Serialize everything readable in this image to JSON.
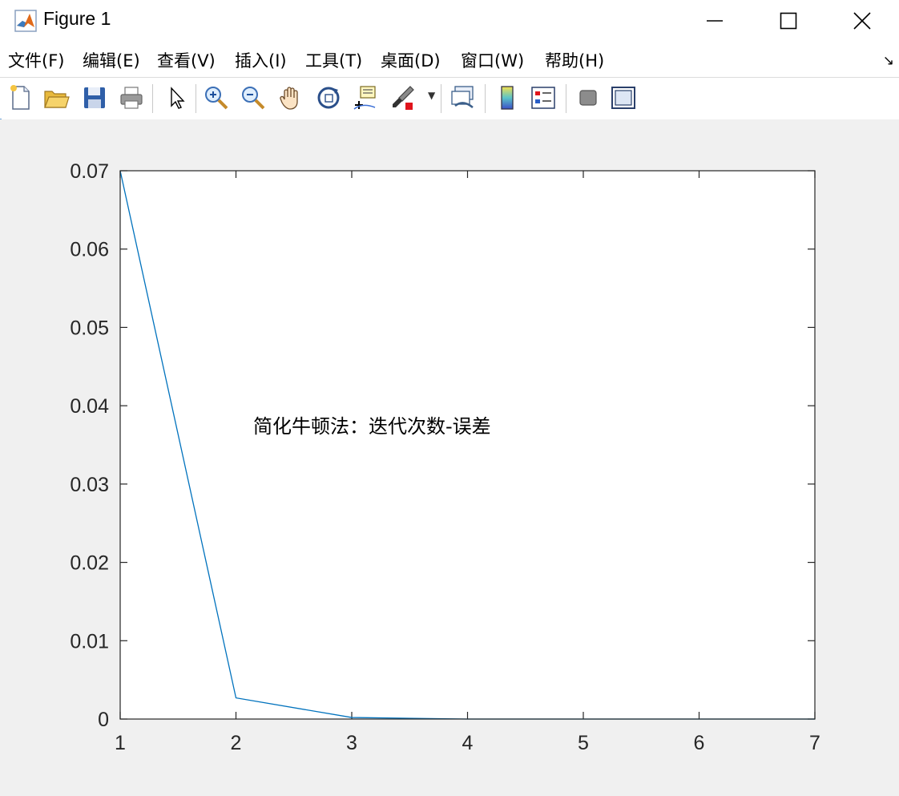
{
  "window": {
    "title": "Figure 1"
  },
  "menu": {
    "items": [
      {
        "label": "文件(F)"
      },
      {
        "label": "编辑(E)"
      },
      {
        "label": "查看(V)"
      },
      {
        "label": "插入(I)"
      },
      {
        "label": "工具(T)"
      },
      {
        "label": "桌面(D)"
      },
      {
        "label": "窗口(W)"
      },
      {
        "label": "帮助(H)"
      }
    ],
    "dock_glyph": "↘"
  },
  "toolbar": {
    "buttons": [
      {
        "icon": "new-figure-icon"
      },
      {
        "icon": "open-file-icon"
      },
      {
        "icon": "save-icon"
      },
      {
        "icon": "print-icon"
      },
      {
        "icon": "edit-plot-arrow-icon"
      },
      {
        "icon": "zoom-in-icon"
      },
      {
        "icon": "zoom-out-icon"
      },
      {
        "icon": "pan-hand-icon"
      },
      {
        "icon": "rotate-3d-icon"
      },
      {
        "icon": "data-cursor-icon"
      },
      {
        "icon": "brush-icon"
      },
      {
        "icon": "link-plot-icon"
      },
      {
        "icon": "colorbar-icon"
      },
      {
        "icon": "legend-icon"
      },
      {
        "icon": "hide-plot-tools-icon"
      },
      {
        "icon": "show-plot-tools-icon"
      }
    ]
  },
  "chart_data": {
    "type": "line",
    "title": "",
    "xlabel": "",
    "ylabel": "",
    "annotation": "简化牛顿法：迭代次数-误差",
    "xlim": [
      1,
      7
    ],
    "ylim": [
      0,
      0.07
    ],
    "x_ticks": [
      "1",
      "2",
      "3",
      "4",
      "5",
      "6",
      "7"
    ],
    "y_ticks": [
      "0",
      "0.01",
      "0.02",
      "0.03",
      "0.04",
      "0.05",
      "0.06",
      "0.07"
    ],
    "x": [
      1,
      2,
      3,
      4,
      5,
      6,
      7
    ],
    "y": [
      0.07,
      0.0027,
      0.0002,
      0.0,
      0.0,
      0.0,
      0.0
    ],
    "line_color": "#0072bd",
    "grid": false
  }
}
